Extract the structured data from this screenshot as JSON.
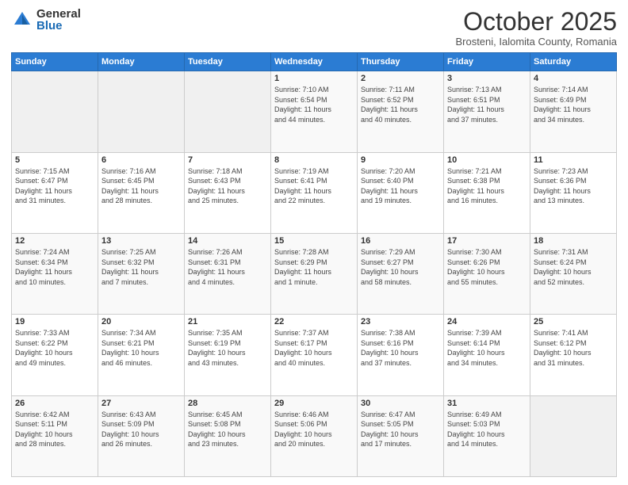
{
  "header": {
    "logo_general": "General",
    "logo_blue": "Blue",
    "month_title": "October 2025",
    "subtitle": "Brosteni, Ialomita County, Romania"
  },
  "weekdays": [
    "Sunday",
    "Monday",
    "Tuesday",
    "Wednesday",
    "Thursday",
    "Friday",
    "Saturday"
  ],
  "weeks": [
    [
      {
        "day": "",
        "info": ""
      },
      {
        "day": "",
        "info": ""
      },
      {
        "day": "",
        "info": ""
      },
      {
        "day": "1",
        "info": "Sunrise: 7:10 AM\nSunset: 6:54 PM\nDaylight: 11 hours\nand 44 minutes."
      },
      {
        "day": "2",
        "info": "Sunrise: 7:11 AM\nSunset: 6:52 PM\nDaylight: 11 hours\nand 40 minutes."
      },
      {
        "day": "3",
        "info": "Sunrise: 7:13 AM\nSunset: 6:51 PM\nDaylight: 11 hours\nand 37 minutes."
      },
      {
        "day": "4",
        "info": "Sunrise: 7:14 AM\nSunset: 6:49 PM\nDaylight: 11 hours\nand 34 minutes."
      }
    ],
    [
      {
        "day": "5",
        "info": "Sunrise: 7:15 AM\nSunset: 6:47 PM\nDaylight: 11 hours\nand 31 minutes."
      },
      {
        "day": "6",
        "info": "Sunrise: 7:16 AM\nSunset: 6:45 PM\nDaylight: 11 hours\nand 28 minutes."
      },
      {
        "day": "7",
        "info": "Sunrise: 7:18 AM\nSunset: 6:43 PM\nDaylight: 11 hours\nand 25 minutes."
      },
      {
        "day": "8",
        "info": "Sunrise: 7:19 AM\nSunset: 6:41 PM\nDaylight: 11 hours\nand 22 minutes."
      },
      {
        "day": "9",
        "info": "Sunrise: 7:20 AM\nSunset: 6:40 PM\nDaylight: 11 hours\nand 19 minutes."
      },
      {
        "day": "10",
        "info": "Sunrise: 7:21 AM\nSunset: 6:38 PM\nDaylight: 11 hours\nand 16 minutes."
      },
      {
        "day": "11",
        "info": "Sunrise: 7:23 AM\nSunset: 6:36 PM\nDaylight: 11 hours\nand 13 minutes."
      }
    ],
    [
      {
        "day": "12",
        "info": "Sunrise: 7:24 AM\nSunset: 6:34 PM\nDaylight: 11 hours\nand 10 minutes."
      },
      {
        "day": "13",
        "info": "Sunrise: 7:25 AM\nSunset: 6:32 PM\nDaylight: 11 hours\nand 7 minutes."
      },
      {
        "day": "14",
        "info": "Sunrise: 7:26 AM\nSunset: 6:31 PM\nDaylight: 11 hours\nand 4 minutes."
      },
      {
        "day": "15",
        "info": "Sunrise: 7:28 AM\nSunset: 6:29 PM\nDaylight: 11 hours\nand 1 minute."
      },
      {
        "day": "16",
        "info": "Sunrise: 7:29 AM\nSunset: 6:27 PM\nDaylight: 10 hours\nand 58 minutes."
      },
      {
        "day": "17",
        "info": "Sunrise: 7:30 AM\nSunset: 6:26 PM\nDaylight: 10 hours\nand 55 minutes."
      },
      {
        "day": "18",
        "info": "Sunrise: 7:31 AM\nSunset: 6:24 PM\nDaylight: 10 hours\nand 52 minutes."
      }
    ],
    [
      {
        "day": "19",
        "info": "Sunrise: 7:33 AM\nSunset: 6:22 PM\nDaylight: 10 hours\nand 49 minutes."
      },
      {
        "day": "20",
        "info": "Sunrise: 7:34 AM\nSunset: 6:21 PM\nDaylight: 10 hours\nand 46 minutes."
      },
      {
        "day": "21",
        "info": "Sunrise: 7:35 AM\nSunset: 6:19 PM\nDaylight: 10 hours\nand 43 minutes."
      },
      {
        "day": "22",
        "info": "Sunrise: 7:37 AM\nSunset: 6:17 PM\nDaylight: 10 hours\nand 40 minutes."
      },
      {
        "day": "23",
        "info": "Sunrise: 7:38 AM\nSunset: 6:16 PM\nDaylight: 10 hours\nand 37 minutes."
      },
      {
        "day": "24",
        "info": "Sunrise: 7:39 AM\nSunset: 6:14 PM\nDaylight: 10 hours\nand 34 minutes."
      },
      {
        "day": "25",
        "info": "Sunrise: 7:41 AM\nSunset: 6:12 PM\nDaylight: 10 hours\nand 31 minutes."
      }
    ],
    [
      {
        "day": "26",
        "info": "Sunrise: 6:42 AM\nSunset: 5:11 PM\nDaylight: 10 hours\nand 28 minutes."
      },
      {
        "day": "27",
        "info": "Sunrise: 6:43 AM\nSunset: 5:09 PM\nDaylight: 10 hours\nand 26 minutes."
      },
      {
        "day": "28",
        "info": "Sunrise: 6:45 AM\nSunset: 5:08 PM\nDaylight: 10 hours\nand 23 minutes."
      },
      {
        "day": "29",
        "info": "Sunrise: 6:46 AM\nSunset: 5:06 PM\nDaylight: 10 hours\nand 20 minutes."
      },
      {
        "day": "30",
        "info": "Sunrise: 6:47 AM\nSunset: 5:05 PM\nDaylight: 10 hours\nand 17 minutes."
      },
      {
        "day": "31",
        "info": "Sunrise: 6:49 AM\nSunset: 5:03 PM\nDaylight: 10 hours\nand 14 minutes."
      },
      {
        "day": "",
        "info": ""
      }
    ]
  ]
}
